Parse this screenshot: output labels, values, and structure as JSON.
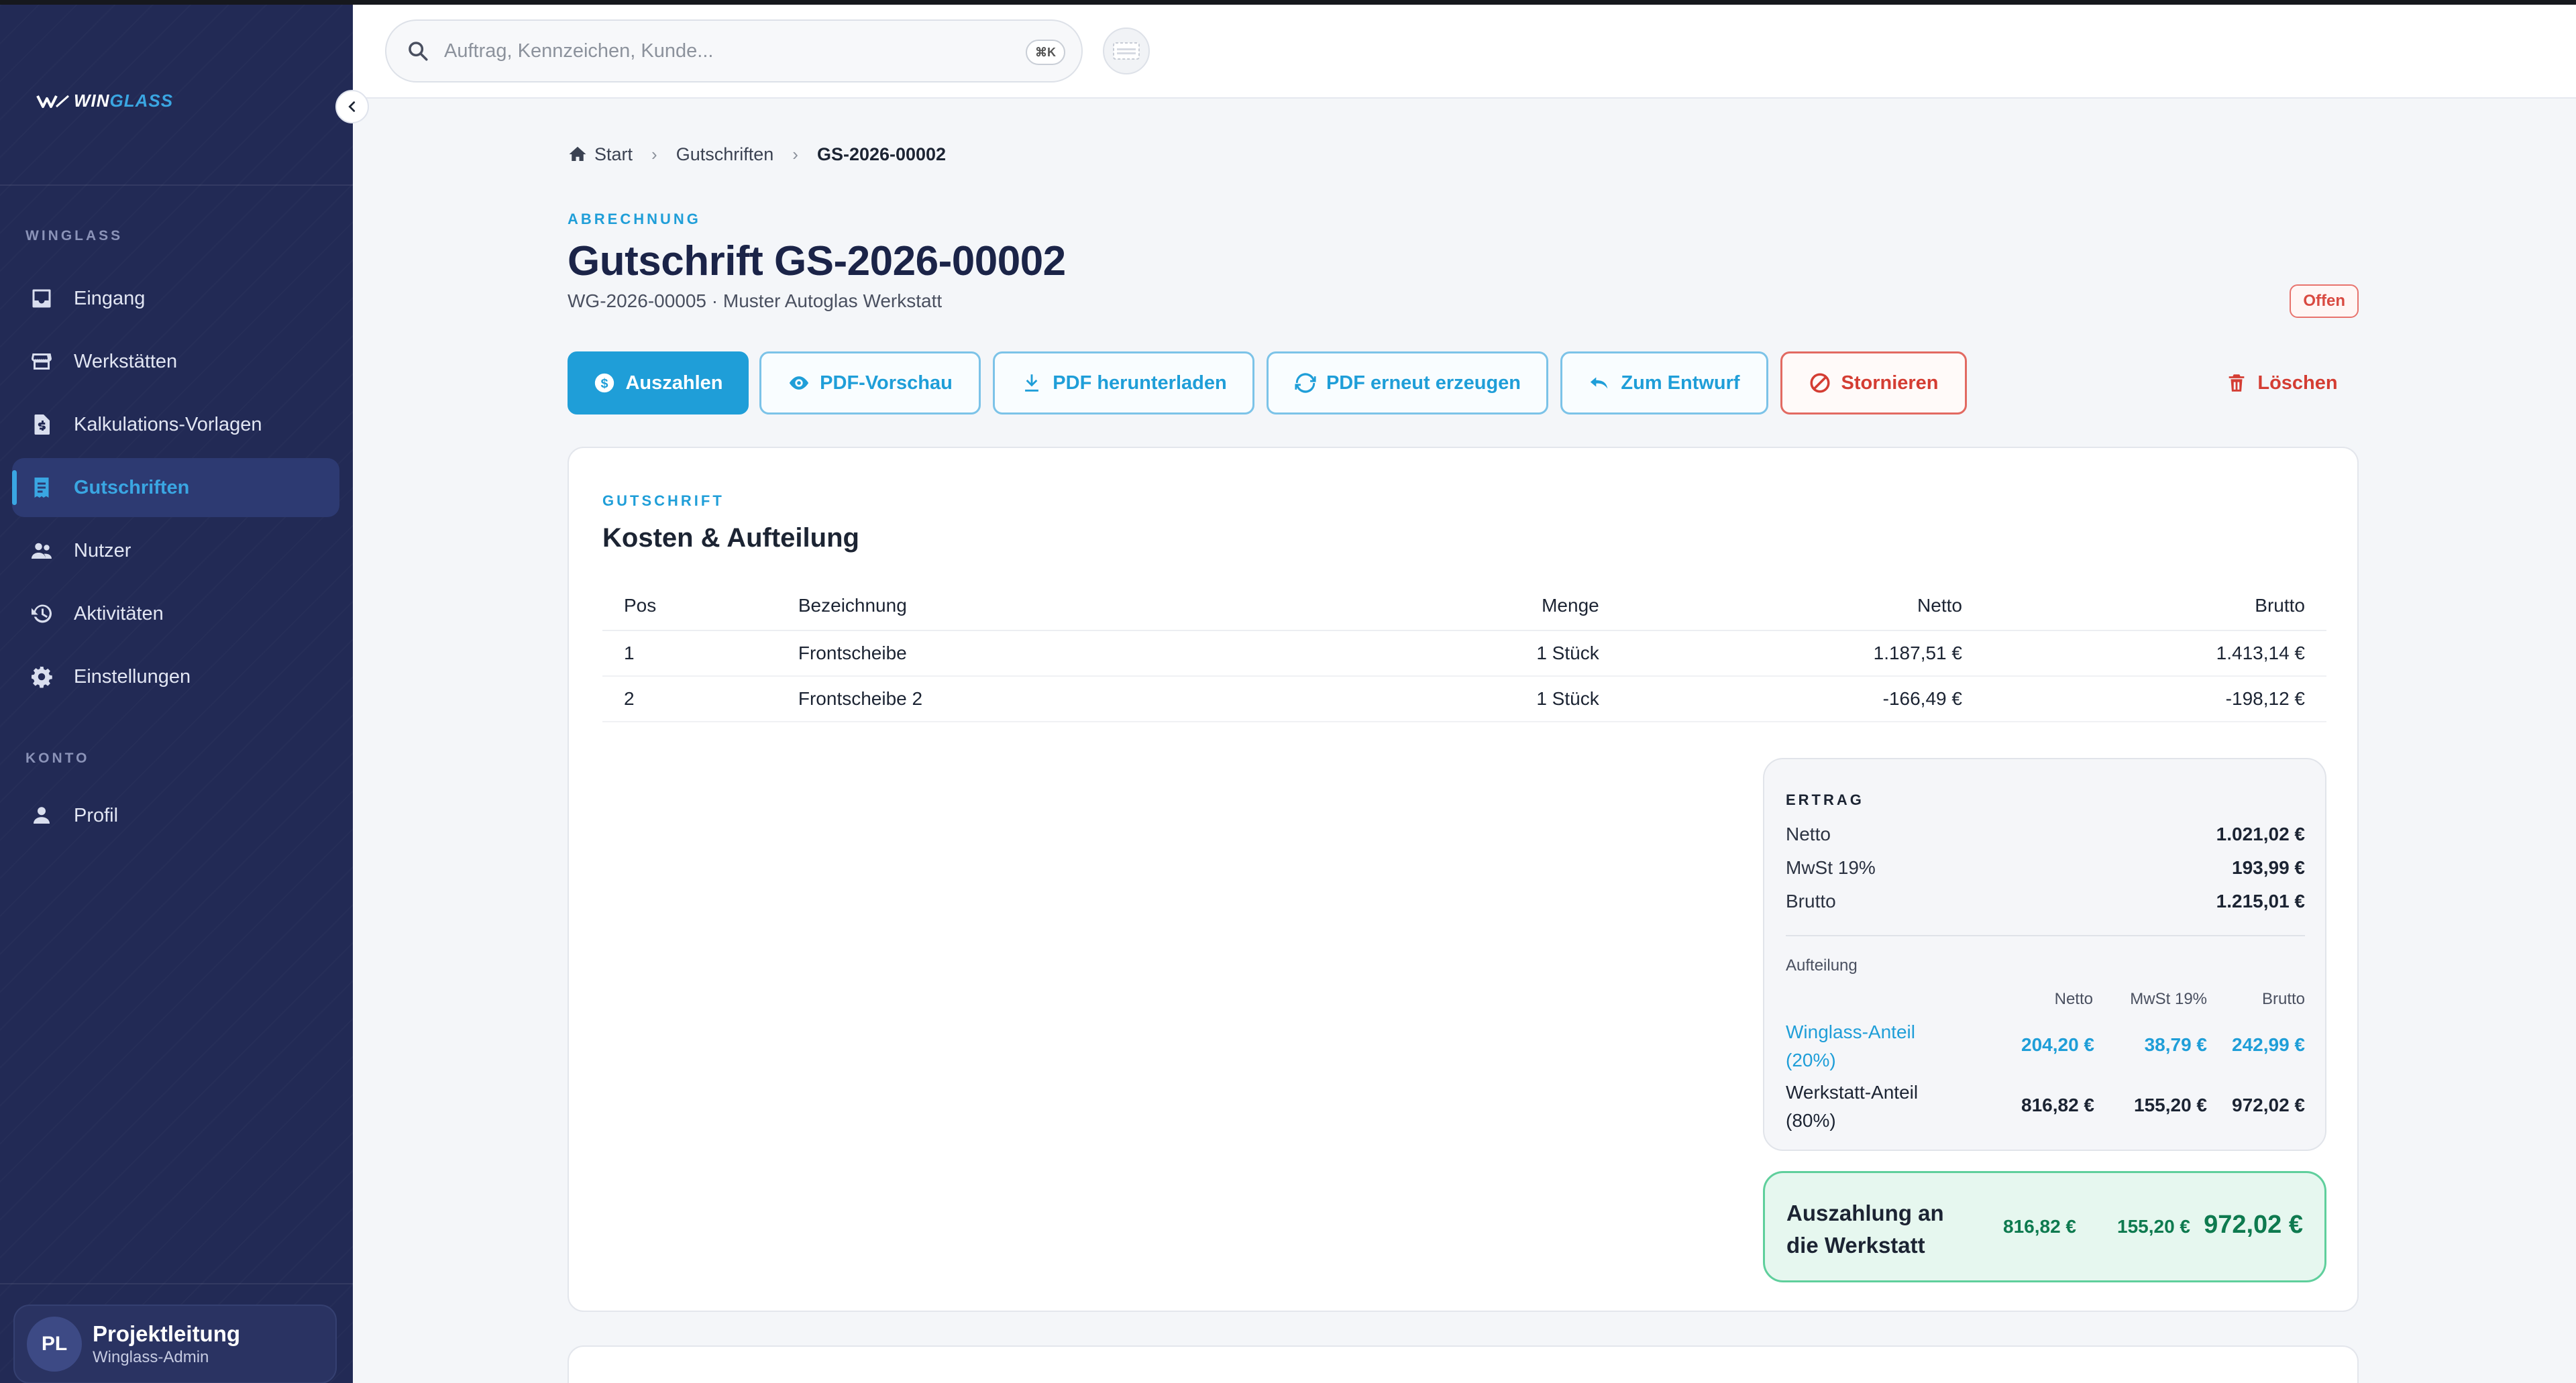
{
  "brand": {
    "name_part1": "WIN",
    "name_part2": "GLASS",
    "accent": "#1f9ed8"
  },
  "search": {
    "placeholder": "Auftrag, Kennzeichen, Kunde...",
    "shortcut": "⌘K"
  },
  "sidebar": {
    "sections": [
      {
        "label": "WINGLASS",
        "items": [
          {
            "label": "Eingang",
            "icon": "inbox-icon"
          },
          {
            "label": "Werkstätten",
            "icon": "store-icon"
          },
          {
            "label": "Kalkulations-Vorlagen",
            "icon": "calc-document-icon"
          },
          {
            "label": "Gutschriften",
            "icon": "receipt-icon",
            "active": true
          },
          {
            "label": "Nutzer",
            "icon": "users-icon"
          },
          {
            "label": "Aktivitäten",
            "icon": "history-icon"
          },
          {
            "label": "Einstellungen",
            "icon": "gear-icon"
          }
        ]
      },
      {
        "label": "KONTO",
        "items": [
          {
            "label": "Profil",
            "icon": "person-icon"
          }
        ]
      }
    ],
    "user": {
      "initials": "PL",
      "name": "Projektleitung",
      "role": "Winglass-Admin"
    }
  },
  "breadcrumb": {
    "home": "Start",
    "section": "Gutschriften",
    "current": "GS-2026-00002"
  },
  "header": {
    "eyebrow": "ABRECHNUNG",
    "title": "Gutschrift GS-2026-00002",
    "subtitle": "WG-2026-00005 · Muster Autoglas Werkstatt",
    "status": "Offen"
  },
  "actions": {
    "pay": "Auszahlen",
    "preview": "PDF-Vorschau",
    "download": "PDF herunterladen",
    "regenerate": "PDF erneut erzeugen",
    "draft": "Zum Entwurf",
    "cancel": "Stornieren",
    "delete": "Löschen"
  },
  "card": {
    "eyebrow": "GUTSCHRIFT",
    "title": "Kosten & Aufteilung",
    "columns": [
      "Pos",
      "Bezeichnung",
      "Menge",
      "Netto",
      "Brutto"
    ],
    "rows": [
      {
        "pos": "1",
        "name": "Frontscheibe",
        "qty": "1 Stück",
        "net": "1.187,51 €",
        "gross": "1.413,14 €"
      },
      {
        "pos": "2",
        "name": "Frontscheibe 2",
        "qty": "1 Stück",
        "net": "-166,49 €",
        "gross": "-198,12 €"
      }
    ]
  },
  "ertrag": {
    "label": "ERTRAG",
    "netto_label": "Netto",
    "netto": "1.021,02 €",
    "mwst_label": "MwSt 19%",
    "mwst": "193,99 €",
    "brutto_label": "Brutto",
    "brutto": "1.215,01 €",
    "split_label": "Aufteilung",
    "split_columns": [
      "Netto",
      "MwSt 19%",
      "Brutto"
    ],
    "winglass": {
      "label": "Winglass-Anteil (20%)",
      "net": "204,20 €",
      "vat": "38,79 €",
      "gross": "242,99 €"
    },
    "workshop": {
      "label": "Werkstatt-Anteil (80%)",
      "net": "816,82 €",
      "vat": "155,20 €",
      "gross": "972,02 €"
    }
  },
  "payout": {
    "label": "Auszahlung an die Werkstatt",
    "net": "816,82 €",
    "vat": "155,20 €",
    "gross": "972,02 €"
  }
}
